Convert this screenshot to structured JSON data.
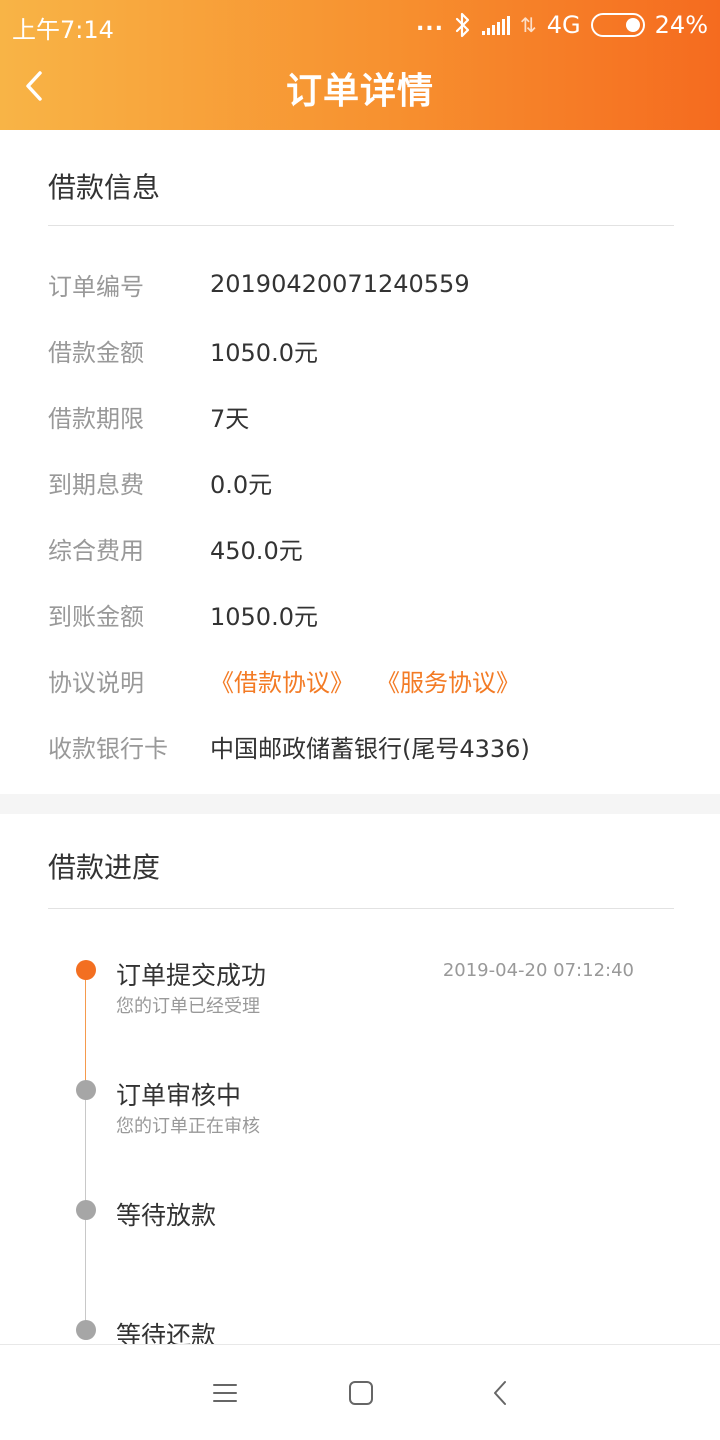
{
  "status_bar": {
    "time": "上午7:14",
    "dots": "...",
    "network": "4G",
    "battery": "24%",
    "battery_level": 0.24
  },
  "header": {
    "title": "订单详情"
  },
  "loan_info": {
    "section_title": "借款信息",
    "rows": [
      {
        "label": "订单编号",
        "value": "20190420071240559"
      },
      {
        "label": "借款金额",
        "value": "1050.0元"
      },
      {
        "label": "借款期限",
        "value": "7天"
      },
      {
        "label": "到期息费",
        "value": "0.0元"
      },
      {
        "label": "综合费用",
        "value": "450.0元"
      },
      {
        "label": "到账金额",
        "value": "1050.0元"
      }
    ],
    "agreement": {
      "label": "协议说明",
      "links": [
        "《借款协议》",
        "《服务协议》"
      ]
    },
    "bank": {
      "label": "收款银行卡",
      "value": "中国邮政储蓄银行(尾号4336)"
    }
  },
  "progress": {
    "section_title": "借款进度",
    "steps": [
      {
        "title": "订单提交成功",
        "desc": "您的订单已经受理",
        "time": "2019-04-20 07:12:40",
        "active": true
      },
      {
        "title": "订单审核中",
        "desc": "您的订单正在审核",
        "time": "",
        "active": false
      },
      {
        "title": "等待放款",
        "desc": "",
        "time": "",
        "active": false
      },
      {
        "title": "等待还款",
        "desc": "",
        "time": "",
        "active": false
      }
    ]
  },
  "colors": {
    "accent": "#f37b25",
    "active_dot": "#f36f21",
    "inactive_dot": "#a6a6a6",
    "header_start": "#f8b446",
    "header_end": "#f56b1f"
  }
}
